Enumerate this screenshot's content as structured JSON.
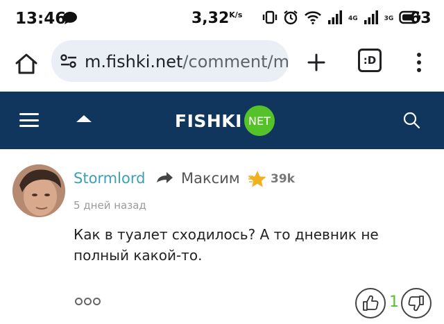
{
  "status_bar": {
    "time": "13:46",
    "speed": "3,32",
    "speed_unit": "K/s",
    "lte_label": "4G",
    "g3_label": "3G",
    "battery": "63"
  },
  "browser": {
    "url_host": "m.fishki.net",
    "url_path": "/comment/mo",
    "tabs_label": ":D"
  },
  "site": {
    "logo_text": "FISHKI",
    "logo_badge": "NET"
  },
  "comment": {
    "author": "Stormlord",
    "recipient": "Максим",
    "karma": "39k",
    "timestamp": "5 дней назад",
    "text": "Как в туалет сходилось? А то дневник не полный какой-то.",
    "score": "1"
  },
  "colors": {
    "header_bg": "#10365e",
    "accent_green": "#55c22a",
    "author_link": "#3aa0bc"
  }
}
